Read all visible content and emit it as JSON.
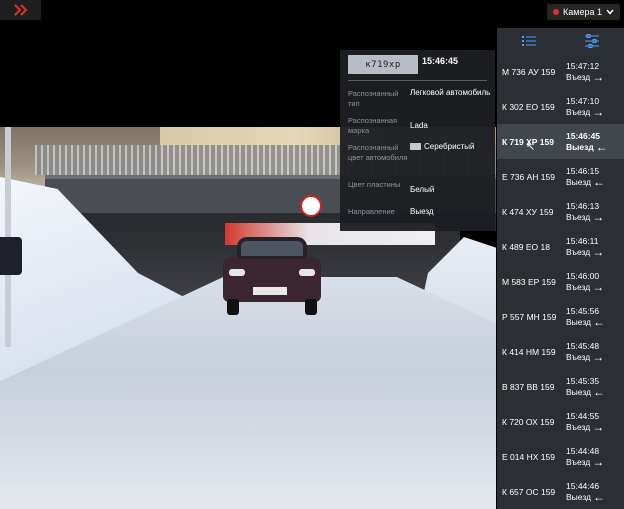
{
  "colors": {
    "accent": "#e03030",
    "panel_bg": "#2b2e33",
    "selected_row": "#42464d"
  },
  "topbar": {
    "expand_icon": "double-chevron-right-icon",
    "camera_label": "Камера 1"
  },
  "popup": {
    "plate": "к719хр",
    "time": "15:46:45",
    "fields": [
      {
        "label": "Распознанный тип",
        "value": "Легковой автомобиль"
      },
      {
        "label": "Распознанная марка",
        "value": "Lada"
      },
      {
        "label": "Распознанный цвет автомобиля",
        "value": "Серебристый"
      },
      {
        "label": "Цвет пластины",
        "value": "Белый"
      },
      {
        "label": "Направление",
        "value": "Выезд"
      }
    ]
  },
  "events": [
    {
      "plate": "М 736 АУ 159",
      "time": "15:47:12",
      "direction": "Въезд"
    },
    {
      "plate": "К 302 ЕО 159",
      "time": "15:47:10",
      "direction": "Въезд"
    },
    {
      "plate": "К 719 ХР 159",
      "time": "15:46:45",
      "direction": "Выезд"
    },
    {
      "plate": "Е 736 АН 159",
      "time": "15:46:15",
      "direction": "Выезд"
    },
    {
      "plate": "К 474 ХУ 159",
      "time": "15:46:13",
      "direction": "Въезд"
    },
    {
      "plate": "К 489 ЕО 18",
      "time": "15:46:11",
      "direction": "Въезд"
    },
    {
      "plate": "М 583 ЕР 159",
      "time": "15:46:00",
      "direction": "Въезд"
    },
    {
      "plate": "Р 557 МН 159",
      "time": "15:45:56",
      "direction": "Выезд"
    },
    {
      "plate": "К 414 НМ 159",
      "time": "15:45:48",
      "direction": "Въезд"
    },
    {
      "plate": "В 837 ВВ 159",
      "time": "15:45:35",
      "direction": "Выезд"
    },
    {
      "plate": "К 720 ОХ 159",
      "time": "15:44:55",
      "direction": "Въезд"
    },
    {
      "plate": "Е 014 НХ 159",
      "time": "15:44:48",
      "direction": "Въезд"
    },
    {
      "plate": "К 657 ОС 159",
      "time": "15:44:46",
      "direction": "Выезд"
    }
  ]
}
